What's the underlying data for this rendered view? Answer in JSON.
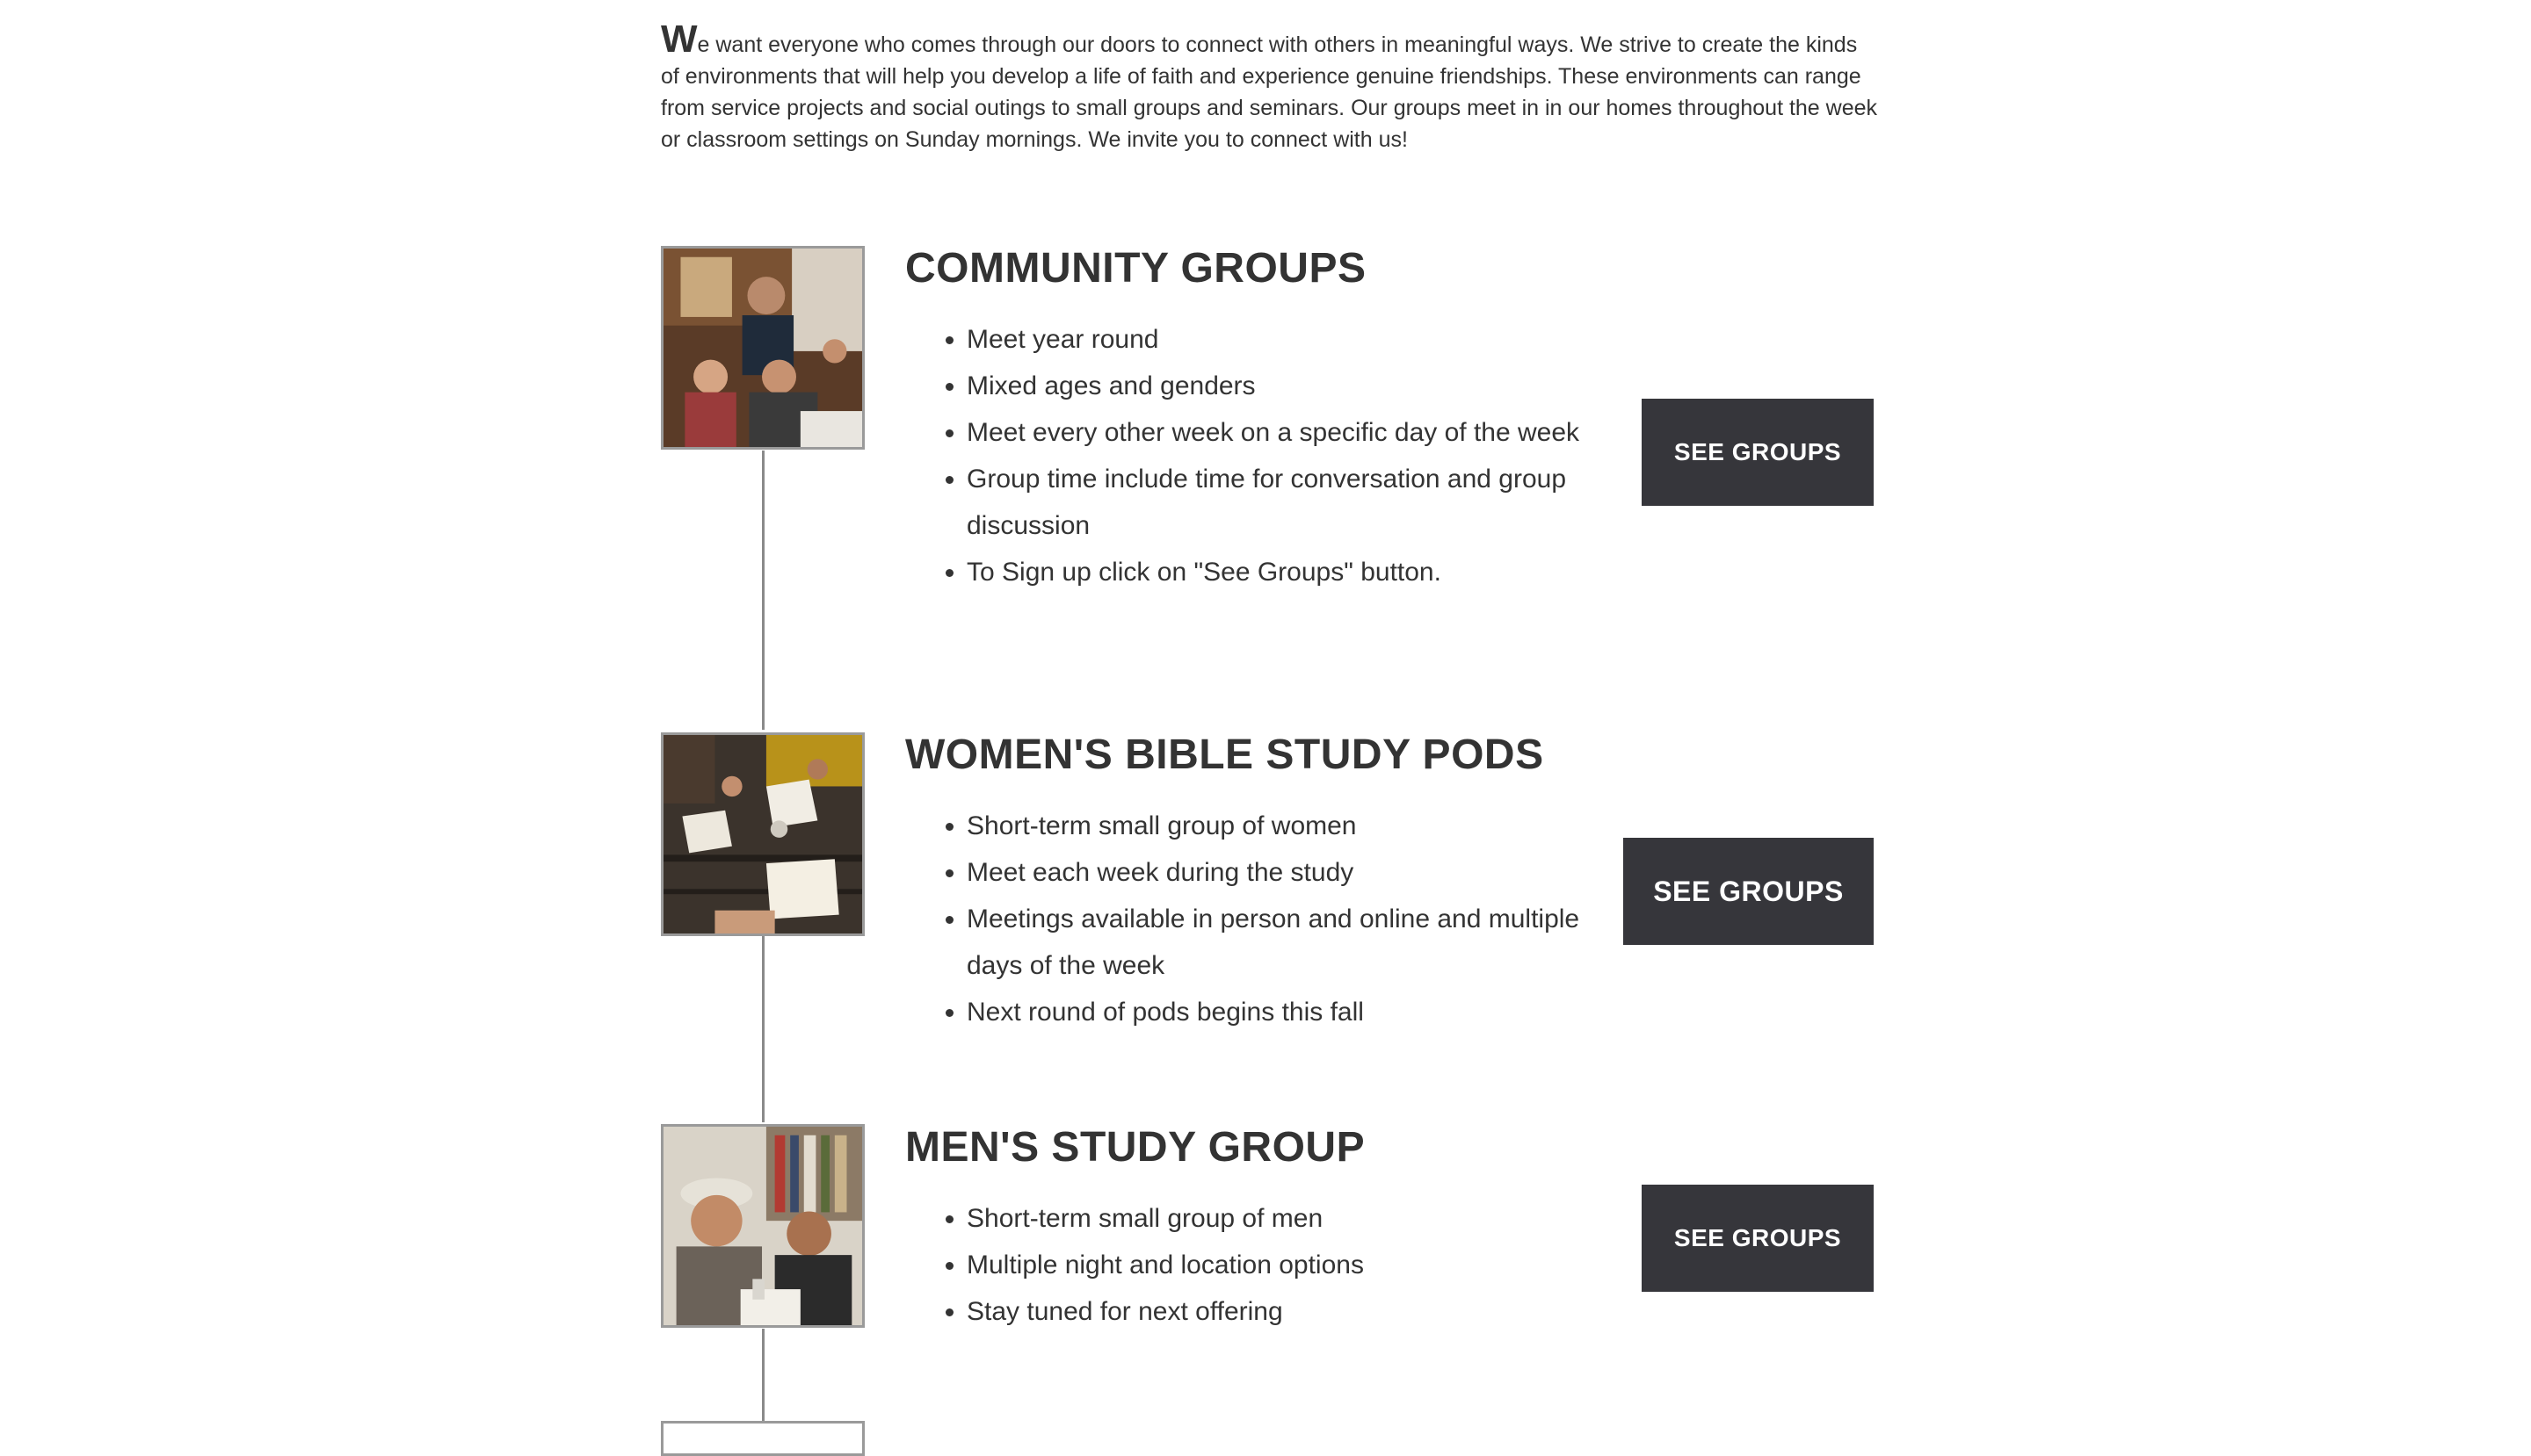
{
  "intro": {
    "dropcap": "W",
    "text": "e want everyone who comes through our doors to connect with others in meaningful ways. We strive to create the kinds of environments that will help you develop a life of faith and experience genuine friendships. These environments can range from service projects and social outings to small groups and seminars. Our groups meet in in our homes throughout the week or classroom settings on Sunday mornings. We invite you to connect with us!"
  },
  "groups": [
    {
      "title": "COMMUNITY GROUPS",
      "items": [
        "Meet year round",
        "Mixed ages and genders",
        "Meet every other week on a specific day of the week",
        "Group time include time for conversation and group discussion",
        "To Sign up click on \"See Groups\" button."
      ],
      "button": "SEE GROUPS",
      "image_icon": "community-group-photo"
    },
    {
      "title": "WOMEN'S BIBLE STUDY PODS",
      "items": [
        "Short-term small group of women",
        "Meet each week during the study",
        "Meetings available in person and online and multiple days of the week",
        "Next round of pods begins this fall"
      ],
      "button": "SEE GROUPS",
      "image_icon": "womens-bible-study-photo"
    },
    {
      "title": "MEN'S STUDY GROUP",
      "items": [
        "Short-term small group of men",
        "Multiple night and location options",
        "Stay tuned for next offering"
      ],
      "button": "SEE GROUPS",
      "image_icon": "mens-study-photo"
    }
  ],
  "colors": {
    "button_bg": "#36363b",
    "text": "#333333",
    "timeline": "#8a8a8a"
  }
}
